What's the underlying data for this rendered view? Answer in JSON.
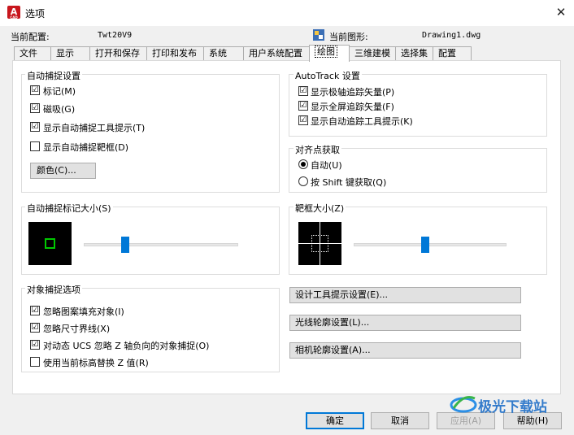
{
  "window": {
    "title": "选项",
    "app_icon_letter": "A",
    "app_icon_sub": "CAD",
    "close_glyph": "✕"
  },
  "header": {
    "profile_label": "当前配置:",
    "profile_value": "Twt20V9",
    "drawing_label": "当前图形:",
    "drawing_value": "Drawing1.dwg"
  },
  "tabs": [
    {
      "label": "文件"
    },
    {
      "label": "显示"
    },
    {
      "label": "打开和保存"
    },
    {
      "label": "打印和发布"
    },
    {
      "label": "系统"
    },
    {
      "label": "用户系统配置"
    },
    {
      "label": "绘图"
    },
    {
      "label": "三维建模"
    },
    {
      "label": "选择集"
    },
    {
      "label": "配置"
    }
  ],
  "active_tab": "绘图",
  "autosnap": {
    "title": "自动捕捉设置",
    "items": [
      {
        "label": "标记(M)",
        "checked": true,
        "mark": "☑"
      },
      {
        "label": "磁吸(G)",
        "checked": true,
        "mark": "☑"
      },
      {
        "label": "显示自动捕捉工具提示(T)",
        "checked": true,
        "mark": "☑"
      },
      {
        "label": "显示自动捕捉靶框(D)",
        "checked": false,
        "mark": ""
      }
    ],
    "color_button": "颜色(C)..."
  },
  "autotrack": {
    "title": "AutoTrack 设置",
    "items": [
      {
        "label": "显示极轴追踪矢量(P)",
        "checked": true,
        "mark": "☑"
      },
      {
        "label": "显示全屏追踪矢量(F)",
        "checked": true,
        "mark": "☑"
      },
      {
        "label": "显示自动追踪工具提示(K)",
        "checked": true,
        "mark": "☑"
      }
    ]
  },
  "alignment": {
    "title": "对齐点获取",
    "options": [
      {
        "label": "自动(U)",
        "selected": true
      },
      {
        "label": "按 Shift 键获取(Q)",
        "selected": false
      }
    ]
  },
  "marker_size": {
    "title": "自动捕捉标记大小(S)",
    "level": 0.27
  },
  "aperture_size": {
    "title": "靶框大小(Z)",
    "level": 0.47
  },
  "object_snap": {
    "title": "对象捕捉选项",
    "items": [
      {
        "label": "忽略图案填充对象(I)",
        "checked": true,
        "mark": "☑"
      },
      {
        "label": "忽略尺寸界线(X)",
        "checked": true,
        "mark": "☑"
      },
      {
        "label": "对动态 UCS 忽略 Z 轴负向的对象捕捉(O)",
        "checked": true,
        "mark": "☑"
      },
      {
        "label": "使用当前标高替换 Z 值(R)",
        "checked": false,
        "mark": ""
      }
    ]
  },
  "side_buttons": [
    {
      "label": "设计工具提示设置(E)..."
    },
    {
      "label": "光线轮廓设置(L)..."
    },
    {
      "label": "相机轮廓设置(A)..."
    }
  ],
  "footer": {
    "ok": "确定",
    "cancel": "取消",
    "apply": "应用(A)",
    "help": "帮助(H)"
  },
  "watermark": "极光下载站",
  "colors": {
    "accent": "#0078d7",
    "marker_green": "#00c800",
    "title_icon": "#c8161d"
  }
}
